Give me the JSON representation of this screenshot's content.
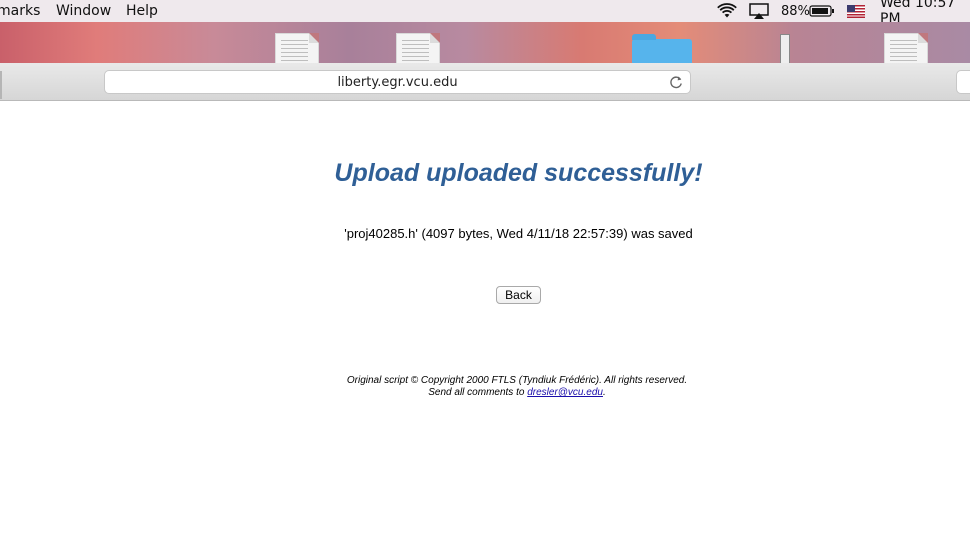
{
  "menubar": {
    "menus": [
      "marks",
      "Window",
      "Help"
    ],
    "battery_percent": "88%",
    "clock": "Wed 10:57 PM"
  },
  "browser": {
    "url": "liberty.egr.vcu.edu"
  },
  "page": {
    "heading": "Upload uploaded successfully!",
    "saved_message": "'proj40285.h' (4097 bytes, Wed 4/11/18 22:57:39) was saved",
    "back_label": "Back",
    "copyright": "Original script © Copyright 2000 FTLS (Tyndiuk Frédéric). All rights reserved.",
    "comments_prefix": "Send all comments to ",
    "comments_email": "dresler@vcu.edu",
    "comments_suffix": "."
  },
  "colors": {
    "heading": "#2f5f96",
    "link": "#1a0dab",
    "folder": "#56b4ec"
  },
  "icons": [
    "wifi-icon",
    "airplay-icon",
    "battery-icon",
    "us-flag-icon",
    "reload-icon",
    "document-icon",
    "folder-icon"
  ]
}
